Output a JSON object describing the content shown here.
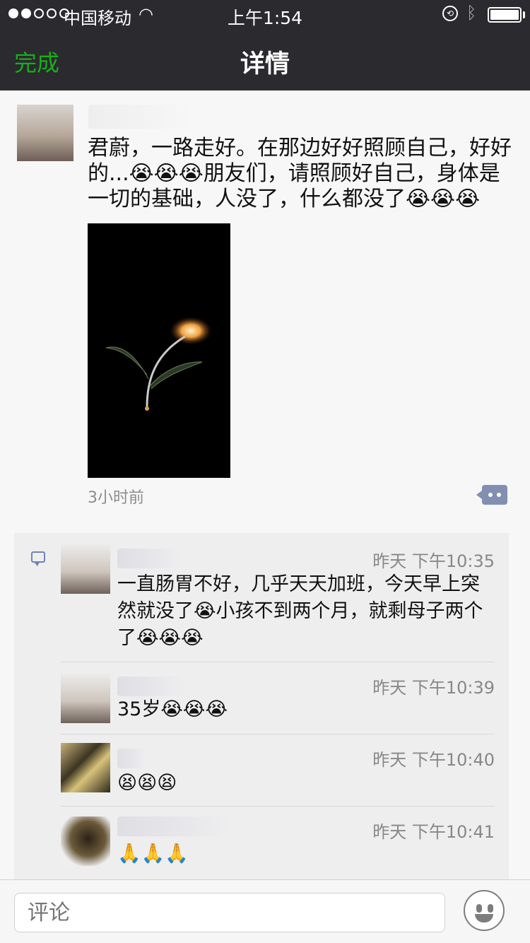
{
  "status_bar": {
    "carrier": "中国移动",
    "time": "上午1:54"
  },
  "nav": {
    "done_label": "完成",
    "title": "详情"
  },
  "post": {
    "text": "君蔚，一路走好。在那边好好照顾自己，好好的...😭😭😭朋友们，请照顾好自己，身体是一切的基础，人没了，什么都没了😭😭😭",
    "time": "3小时前"
  },
  "comments": [
    {
      "time": "昨天 下午10:35",
      "text": "一直肠胃不好，几乎天天加班，今天早上突然就没了😭小孩不到两个月，就剩母子两个了😭😭😭"
    },
    {
      "time": "昨天 下午10:39",
      "text": "35岁😭😭😭"
    },
    {
      "time": "昨天 下午10:40",
      "text": "😫😫😫"
    },
    {
      "time": "昨天 下午10:41",
      "text": "🙏🙏🙏"
    }
  ],
  "input": {
    "placeholder": "评论"
  },
  "colors": {
    "accent_green": "#1aad19",
    "nav_bg": "#2a2a2f",
    "link_blue": "#6e84b5"
  }
}
